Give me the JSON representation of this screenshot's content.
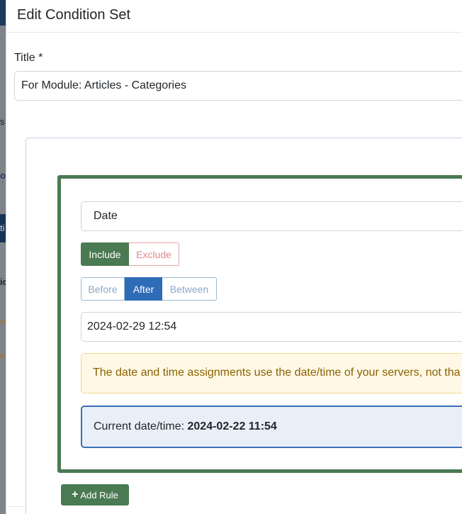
{
  "background": {
    "fragments": [
      "s",
      "o",
      "ti",
      "io",
      "or",
      "e"
    ]
  },
  "modal": {
    "title": "Edit Condition Set"
  },
  "form": {
    "title_label": "Title *",
    "title_value": "For Module: Articles - Categories"
  },
  "rule": {
    "type": "Date",
    "include_label": "Include",
    "exclude_label": "Exclude",
    "selected_mode": "Include",
    "comparison_options": [
      "Before",
      "After",
      "Between"
    ],
    "selected_comparison": "After",
    "date_value": "2024-02-29 12:54",
    "warning_text": "The date and time assignments use the date/time of your servers, not tha",
    "current_label": "Current date/time:",
    "current_value": "2024-02-22 11:54"
  },
  "actions": {
    "add_rule_label": "Add Rule",
    "add_rule_icon": "plus-icon"
  },
  "colors": {
    "green": "#4a7a52",
    "blue": "#2f6cb8",
    "warning_bg": "#fff8e6",
    "info_border": "#3a6fb5"
  }
}
